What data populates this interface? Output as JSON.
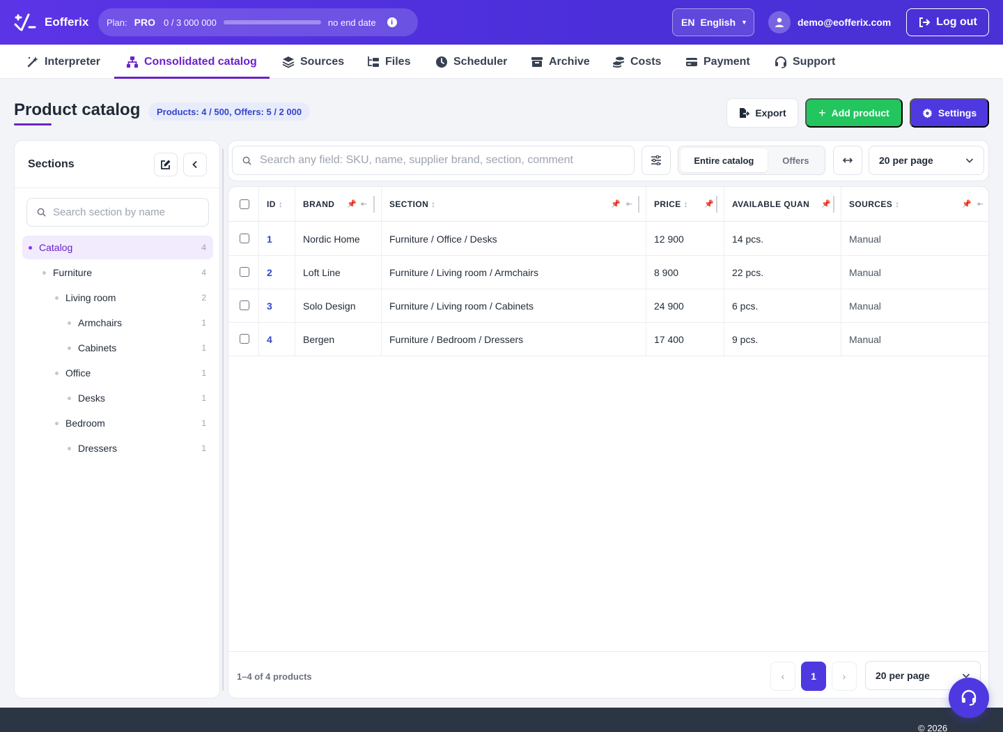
{
  "app": {
    "name": "Eofferix"
  },
  "plan": {
    "label": "Plan:",
    "value": "PRO",
    "usage": "0 / 3 000 000",
    "usage_fraction": 0.0,
    "end": "no end date"
  },
  "language": {
    "code": "EN",
    "name": "English"
  },
  "user": {
    "email": "demo@eofferix.com"
  },
  "logout_label": "Log out",
  "nav": [
    {
      "label": "Interpreter",
      "icon": "wand-icon"
    },
    {
      "label": "Consolidated catalog",
      "icon": "sitemap-icon",
      "active": true
    },
    {
      "label": "Sources",
      "icon": "layers-icon"
    },
    {
      "label": "Files",
      "icon": "folder-tree-icon"
    },
    {
      "label": "Scheduler",
      "icon": "clock-icon"
    },
    {
      "label": "Archive",
      "icon": "archive-icon"
    },
    {
      "label": "Costs",
      "icon": "coins-icon"
    },
    {
      "label": "Payment",
      "icon": "credit-card-icon"
    },
    {
      "label": "Support",
      "icon": "headset-icon"
    }
  ],
  "page": {
    "title": "Product catalog",
    "counts": "Products: 4 / 500, Offers: 5 / 2 000",
    "export_label": "Export",
    "add_label": "Add product",
    "settings_label": "Settings"
  },
  "sidebar": {
    "title": "Sections",
    "search_placeholder": "Search section by name",
    "tree": [
      {
        "label": "Catalog",
        "count": "4",
        "level": 0,
        "active": true
      },
      {
        "label": "Furniture",
        "count": "4",
        "level": 1
      },
      {
        "label": "Living room",
        "count": "2",
        "level": 2
      },
      {
        "label": "Armchairs",
        "count": "1",
        "level": 3
      },
      {
        "label": "Cabinets",
        "count": "1",
        "level": 3
      },
      {
        "label": "Office",
        "count": "1",
        "level": 2
      },
      {
        "label": "Desks",
        "count": "1",
        "level": 3
      },
      {
        "label": "Bedroom",
        "count": "1",
        "level": 2
      },
      {
        "label": "Dressers",
        "count": "1",
        "level": 3
      }
    ]
  },
  "toolbar": {
    "search_placeholder": "Search any field: SKU, name, supplier brand, section, comment",
    "scope_all": "Entire catalog",
    "scope_offers": "Offers",
    "per_page": "20 per page"
  },
  "table": {
    "headers": {
      "id": "ID",
      "brand": "BRAND",
      "section": "SECTION",
      "price": "PRICE",
      "qty": "AVAILABLE QUAN",
      "sources": "SOURCES"
    },
    "rows": [
      {
        "id": "1",
        "brand": "Nordic Home",
        "section": "Furniture / Office / Desks",
        "price": "12 900",
        "qty": "14 pcs.",
        "sources": "Manual"
      },
      {
        "id": "2",
        "brand": "Loft Line",
        "section": "Furniture / Living room / Armchairs",
        "price": "8 900",
        "qty": "22 pcs.",
        "sources": "Manual"
      },
      {
        "id": "3",
        "brand": "Solo Design",
        "section": "Furniture / Living room / Cabinets",
        "price": "24 900",
        "qty": "6 pcs.",
        "sources": "Manual"
      },
      {
        "id": "4",
        "brand": "Bergen",
        "section": "Furniture / Bedroom / Dressers",
        "price": "17 400",
        "qty": "9 pcs.",
        "sources": "Manual"
      }
    ]
  },
  "pagination": {
    "summary": "1–4 of 4 products",
    "current": "1",
    "prev": "‹",
    "next": "›",
    "per_page": "20 per page"
  },
  "footer": {
    "copyright": "© 2026"
  }
}
